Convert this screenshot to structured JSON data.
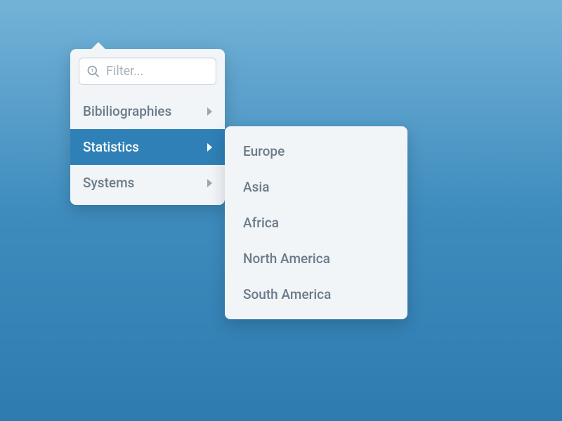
{
  "filter": {
    "placeholder": "Filter..."
  },
  "menu": {
    "items": [
      {
        "label": "Bibiliographies",
        "has_submenu": true,
        "active": false
      },
      {
        "label": "Statistics",
        "has_submenu": true,
        "active": true
      },
      {
        "label": "Systems",
        "has_submenu": true,
        "active": false
      }
    ]
  },
  "submenu": {
    "items": [
      {
        "label": "Europe"
      },
      {
        "label": "Asia"
      },
      {
        "label": "Africa"
      },
      {
        "label": "North America"
      },
      {
        "label": "South America"
      }
    ]
  },
  "colors": {
    "accent": "#2f80b7",
    "panel": "#f2f5f8",
    "text_muted": "#6b7b8a"
  }
}
